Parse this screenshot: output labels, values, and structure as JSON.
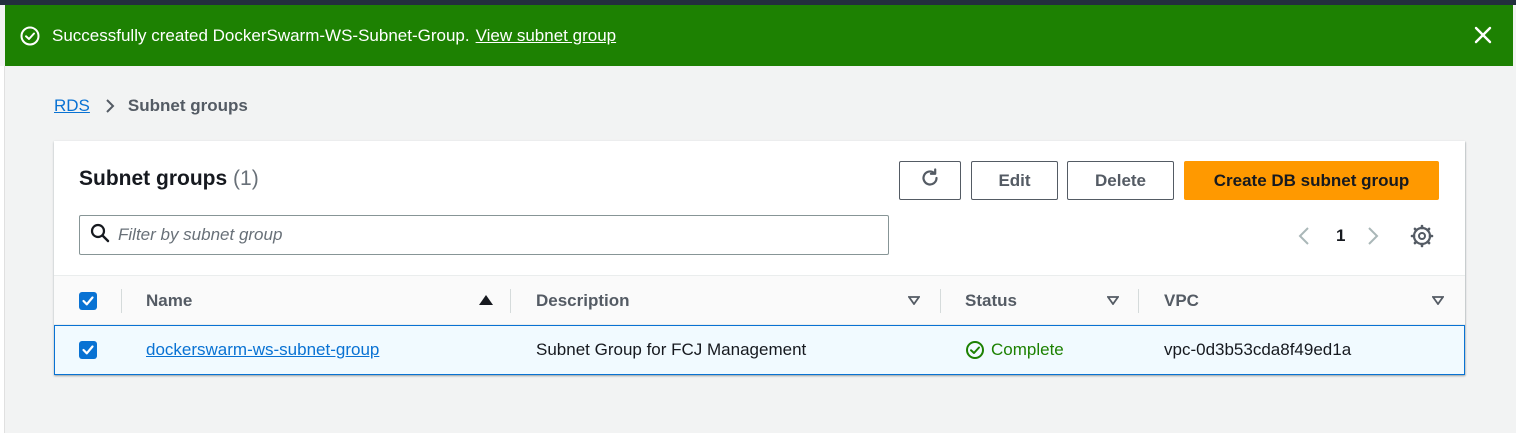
{
  "flash": {
    "message": "Successfully created DockerSwarm-WS-Subnet-Group.",
    "link_text": "View subnet group",
    "color": "#1d8102",
    "icons": {
      "status": "check-circle-icon",
      "close": "close-icon"
    }
  },
  "breadcrumb": {
    "root": "RDS",
    "current": "Subnet groups"
  },
  "panel": {
    "title": "Subnet groups",
    "count": "(1)",
    "buttons": {
      "edit": "Edit",
      "delete": "Delete",
      "create": "Create DB subnet group"
    },
    "accent_color": "#ff9900",
    "filter_placeholder": "Filter by subnet group",
    "pagination": {
      "current_page": "1"
    }
  },
  "table": {
    "columns": {
      "name": "Name",
      "description": "Description",
      "status": "Status",
      "vpc": "VPC"
    },
    "sort": {
      "column": "Name",
      "direction": "ascending"
    },
    "rows": [
      {
        "selected": true,
        "name": "dockerswarm-ws-subnet-group",
        "description": "Subnet Group for FCJ Management",
        "status": "Complete",
        "vpc": "vpc-0d3b53cda8f49ed1a"
      }
    ]
  }
}
